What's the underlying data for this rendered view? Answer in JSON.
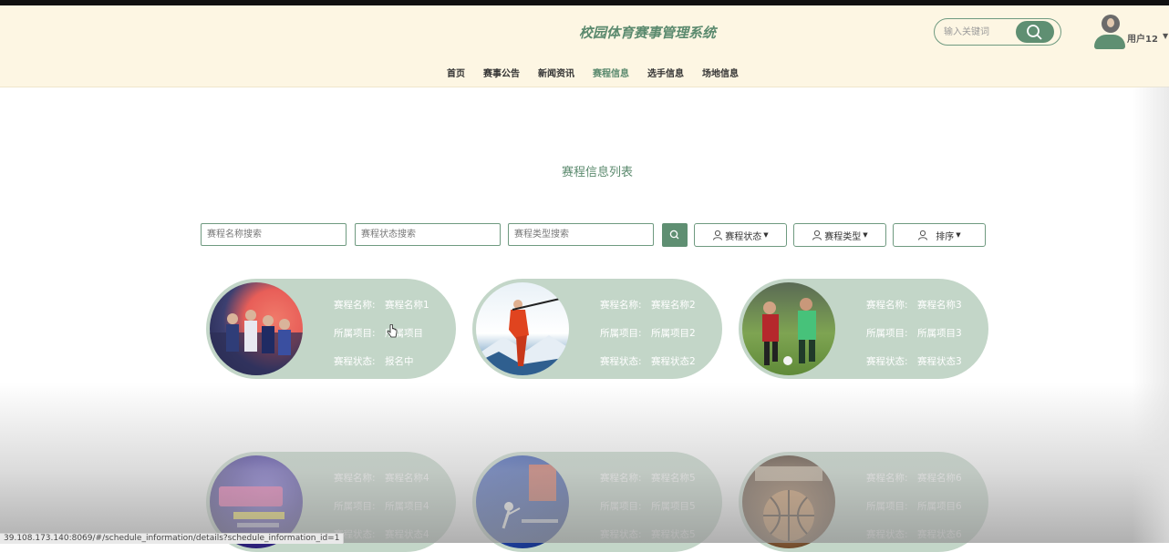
{
  "header": {
    "site_title": "校园体育赛事管理系统",
    "search_placeholder": "输入关键词",
    "user_name": "用户12"
  },
  "nav": {
    "items": [
      {
        "label": "首页"
      },
      {
        "label": "赛事公告"
      },
      {
        "label": "新闻资讯"
      },
      {
        "label": "赛程信息",
        "active": true
      },
      {
        "label": "选手信息"
      },
      {
        "label": "场地信息"
      }
    ]
  },
  "main": {
    "title": "赛程信息列表",
    "filters": {
      "name_placeholder": "赛程名称搜索",
      "status_placeholder": "赛程状态搜索",
      "type_placeholder": "赛程类型搜索",
      "status_dropdown": "赛程状态",
      "type_dropdown": "赛程类型",
      "sort_dropdown": "排序"
    },
    "labels": {
      "name": "赛程名称:",
      "project": "所属项目:",
      "status": "赛程状态:"
    },
    "cards": [
      {
        "name": "赛程名称1",
        "project": "所属项目",
        "status": "报名中"
      },
      {
        "name": "赛程名称2",
        "project": "所属项目2",
        "status": "赛程状态2"
      },
      {
        "name": "赛程名称3",
        "project": "所属项目3",
        "status": "赛程状态3"
      },
      {
        "name": "赛程名称4",
        "project": "所属项目4",
        "status": "赛程状态4"
      },
      {
        "name": "赛程名称5",
        "project": "所属项目5",
        "status": "赛程状态5"
      },
      {
        "name": "赛程名称6",
        "project": "所属项目6",
        "status": "赛程状态6"
      }
    ]
  },
  "status_bar": {
    "url": "39.108.173.140:8069/#/schedule_information/details?schedule_information_id=1"
  },
  "colors": {
    "accent": "#5f8f72",
    "header_bg": "#fdf6e3",
    "card_bg": "#c3d6c8"
  }
}
